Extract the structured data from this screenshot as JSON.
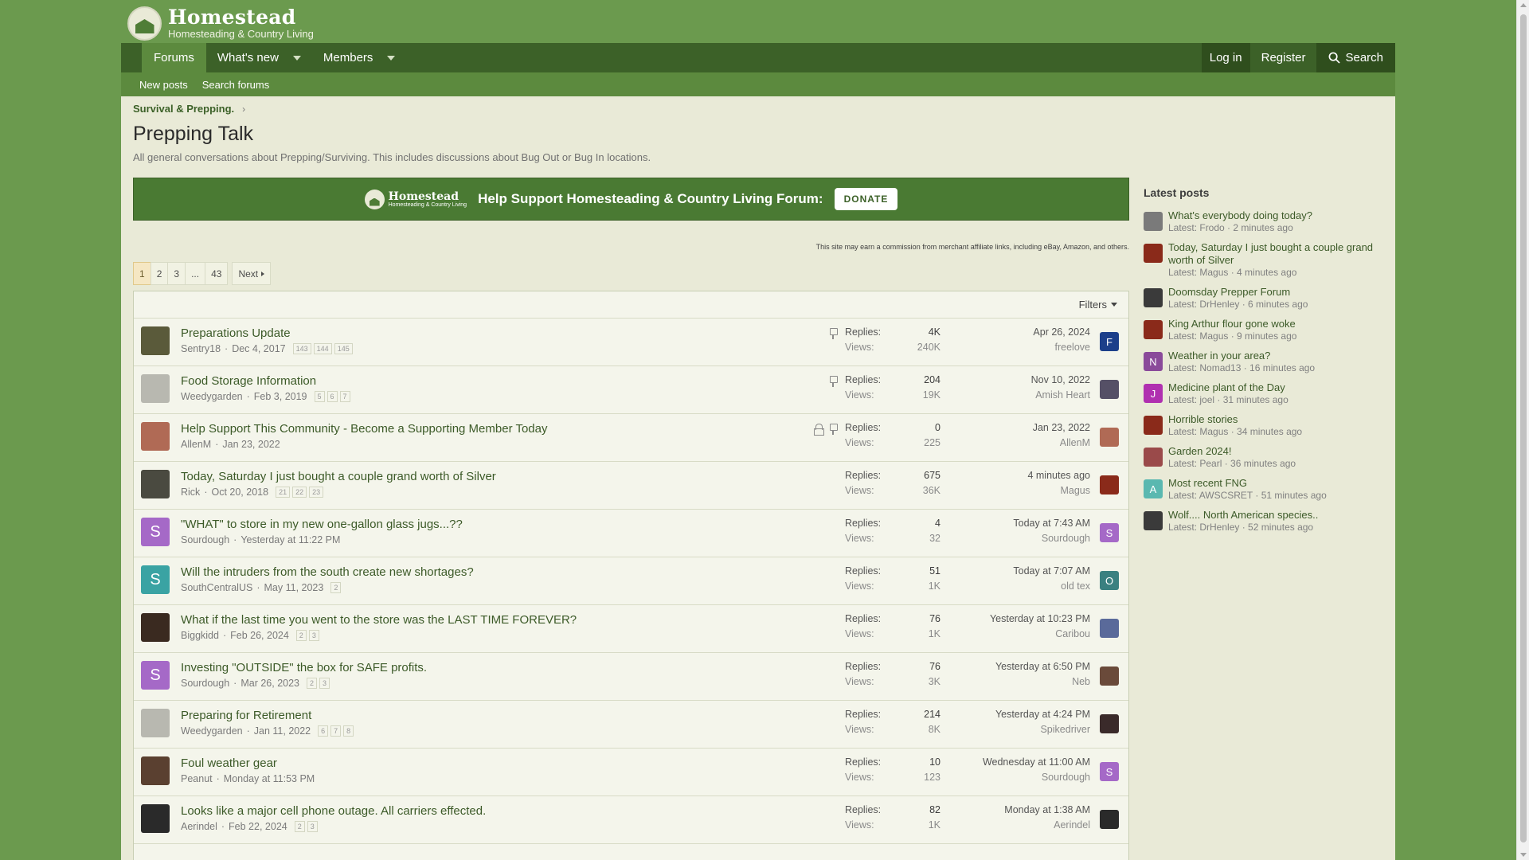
{
  "site": {
    "title": "Homestead",
    "subtitle": "Homesteading & Country Living"
  },
  "nav": {
    "items": [
      {
        "label": "Forums"
      },
      {
        "label": "What's new"
      },
      {
        "label": "Members"
      }
    ],
    "login": "Log in",
    "register": "Register",
    "search": "Search"
  },
  "subnav": {
    "new_posts": "New posts",
    "search_forums": "Search forums"
  },
  "breadcrumb": {
    "parent": "Survival & Prepping.",
    "chevron": "›"
  },
  "page": {
    "title": "Prepping Talk",
    "description": "All general conversations about Prepping/Surviving. This includes discussions about Bug Out or Bug In locations."
  },
  "banner": {
    "logo_title": "Homestead",
    "logo_sub": "Homesteading & Country Living",
    "text": "Help Support Homesteading & Country Living Forum:",
    "donate": "DONATE"
  },
  "affiliate_note": "This site may earn a commission from merchant affiliate links, including eBay, Amazon, and others.",
  "pager": {
    "pages": [
      "1",
      "2",
      "3",
      "...",
      "43"
    ],
    "current": "1",
    "next": "Next"
  },
  "filters": "Filters",
  "labels": {
    "replies": "Replies:",
    "views": "Views:"
  },
  "threads": [
    {
      "title": "Preparations Update",
      "author": "Sentry18",
      "date": "Dec 4, 2017",
      "pages": [
        "143",
        "144",
        "145"
      ],
      "sticky": true,
      "locked": false,
      "replies": "4K",
      "views": "240K",
      "last_time": "Apr 26, 2024",
      "last_user": "freelove",
      "avatar_color": "#5a5a3a",
      "avatar_letter": "",
      "last_avatar_color": "#1c3f8a",
      "last_avatar_letter": "F"
    },
    {
      "title": "Food Storage Information",
      "author": "Weedygarden",
      "date": "Feb 3, 2019",
      "pages": [
        "5",
        "6",
        "7"
      ],
      "sticky": true,
      "locked": false,
      "replies": "204",
      "views": "19K",
      "last_time": "Nov 10, 2022",
      "last_user": "Amish Heart",
      "avatar_color": "#b8b8b0",
      "avatar_letter": "",
      "last_avatar_color": "#555066",
      "last_avatar_letter": ""
    },
    {
      "title": "Help Support This Community - Become a Supporting Member Today",
      "author": "AllenM",
      "date": "Jan 23, 2022",
      "pages": [],
      "sticky": true,
      "locked": true,
      "replies": "0",
      "views": "225",
      "last_time": "Jan 23, 2022",
      "last_user": "AllenM",
      "avatar_color": "#b06a55",
      "avatar_letter": "",
      "last_avatar_color": "#b06a55",
      "last_avatar_letter": ""
    },
    {
      "title": "Today, Saturday I just bought a couple grand worth of Silver",
      "author": "Rick",
      "date": "Oct 20, 2018",
      "pages": [
        "21",
        "22",
        "23"
      ],
      "sticky": false,
      "locked": false,
      "replies": "675",
      "views": "36K",
      "last_time": "4 minutes ago",
      "last_user": "Magus",
      "avatar_color": "#4a4a40",
      "avatar_letter": "",
      "last_avatar_color": "#8a2a1a",
      "last_avatar_letter": ""
    },
    {
      "title": "\"WHAT\" to store in my new one-gallon glass jugs...??",
      "author": "Sourdough",
      "date": "Yesterday at 11:22 PM",
      "pages": [],
      "sticky": false,
      "locked": false,
      "replies": "4",
      "views": "32",
      "last_time": "Today at 7:43 AM",
      "last_user": "Sourdough",
      "avatar_color": "#a569c7",
      "avatar_letter": "S",
      "last_avatar_color": "#a569c7",
      "last_avatar_letter": "S"
    },
    {
      "title": "Will the intruders from the south create new shortages?",
      "author": "SouthCentralUS",
      "date": "May 11, 2023",
      "pages": [
        "2"
      ],
      "sticky": false,
      "locked": false,
      "replies": "51",
      "views": "1K",
      "last_time": "Today at 7:07 AM",
      "last_user": "old tex",
      "avatar_color": "#3aa3a3",
      "avatar_letter": "S",
      "last_avatar_color": "#3a8080",
      "last_avatar_letter": "O"
    },
    {
      "title": "What if the last time you went to the store was the LAST TIME FOREVER?",
      "author": "Biggkidd",
      "date": "Feb 26, 2024",
      "pages": [
        "2",
        "3"
      ],
      "sticky": false,
      "locked": false,
      "replies": "76",
      "views": "1K",
      "last_time": "Yesterday at 10:23 PM",
      "last_user": "Caribou",
      "avatar_color": "#3a2a20",
      "avatar_letter": "",
      "last_avatar_color": "#5a6a9a",
      "last_avatar_letter": ""
    },
    {
      "title": "Investing \"OUTSIDE\" the box for SAFE profits.",
      "author": "Sourdough",
      "date": "Mar 26, 2023",
      "pages": [
        "2",
        "3"
      ],
      "sticky": false,
      "locked": false,
      "replies": "76",
      "views": "3K",
      "last_time": "Yesterday at 6:50 PM",
      "last_user": "Neb",
      "avatar_color": "#a569c7",
      "avatar_letter": "S",
      "last_avatar_color": "#6a4a3a",
      "last_avatar_letter": ""
    },
    {
      "title": "Preparing for Retirement",
      "author": "Weedygarden",
      "date": "Jan 11, 2022",
      "pages": [
        "6",
        "7",
        "8"
      ],
      "sticky": false,
      "locked": false,
      "replies": "214",
      "views": "8K",
      "last_time": "Yesterday at 4:24 PM",
      "last_user": "Spikedriver",
      "avatar_color": "#b8b8b0",
      "avatar_letter": "",
      "last_avatar_color": "#3a2a2a",
      "last_avatar_letter": ""
    },
    {
      "title": "Foul weather gear",
      "author": "Peanut",
      "date": "Monday at 11:53 PM",
      "pages": [],
      "sticky": false,
      "locked": false,
      "replies": "10",
      "views": "123",
      "last_time": "Wednesday at 11:00 AM",
      "last_user": "Sourdough",
      "avatar_color": "#5a4030",
      "avatar_letter": "",
      "last_avatar_color": "#a569c7",
      "last_avatar_letter": "S"
    },
    {
      "title": "Looks like a major cell phone outage. All carriers effected.",
      "author": "Aerindel",
      "date": "Feb 22, 2024",
      "pages": [
        "2",
        "3"
      ],
      "sticky": false,
      "locked": false,
      "replies": "82",
      "views": "1K",
      "last_time": "Monday at 1:38 AM",
      "last_user": "Aerindel",
      "avatar_color": "#2a2a2a",
      "avatar_letter": "",
      "last_avatar_color": "#2a2a2a",
      "last_avatar_letter": ""
    }
  ],
  "sidebar": {
    "heading": "Latest posts",
    "items": [
      {
        "title": "What's everybody doing today?",
        "sub": "Latest: Frodo · 2 minutes ago",
        "color": "#7a7a7a",
        "letter": ""
      },
      {
        "title": "Today, Saturday I just bought a couple grand worth of Silver",
        "sub": "Latest: Magus · 4 minutes ago",
        "color": "#8a2a1a",
        "letter": ""
      },
      {
        "title": "Doomsday Prepper Forum",
        "sub": "Latest: DrHenley · 6 minutes ago",
        "color": "#3a3a3a",
        "letter": ""
      },
      {
        "title": "King Arthur flour gone woke",
        "sub": "Latest: Magus · 9 minutes ago",
        "color": "#8a2a1a",
        "letter": ""
      },
      {
        "title": "Weather in your area?",
        "sub": "Latest: Nomad13 · 16 minutes ago",
        "color": "#8a4a9a",
        "letter": "N"
      },
      {
        "title": "Medicine plant of the Day",
        "sub": "Latest: joel · 31 minutes ago",
        "color": "#b030b0",
        "letter": "J"
      },
      {
        "title": "Horrible stories",
        "sub": "Latest: Magus · 34 minutes ago",
        "color": "#8a2a1a",
        "letter": ""
      },
      {
        "title": "Garden 2024!",
        "sub": "Latest: Pearl · 36 minutes ago",
        "color": "#9a4a4a",
        "letter": ""
      },
      {
        "title": "Most recent FNG",
        "sub": "Latest: AWSCSRET · 51 minutes ago",
        "color": "#5ab8b0",
        "letter": "A"
      },
      {
        "title": "Wolf.... North American species..",
        "sub": "Latest: DrHenley · 52 minutes ago",
        "color": "#3a3a3a",
        "letter": ""
      }
    ]
  }
}
